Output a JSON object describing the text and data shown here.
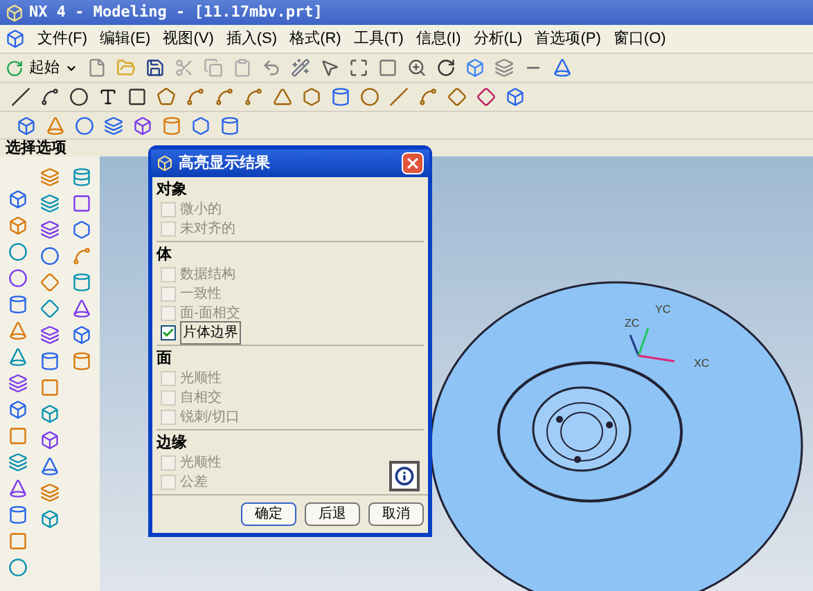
{
  "window": {
    "title": "NX 4 - Modeling - [11.17mbv.prt]"
  },
  "menu": [
    "文件(F)",
    "编辑(E)",
    "视图(V)",
    "插入(S)",
    "格式(R)",
    "工具(T)",
    "信息(I)",
    "分析(L)",
    "首选项(P)",
    "窗口(O)"
  ],
  "toolbar": {
    "start_button": "起始"
  },
  "selection_bar": {
    "label": "选择选项"
  },
  "viewport": {
    "axes": [
      "ZC",
      "YC",
      "XC"
    ]
  },
  "dialog": {
    "title": "高亮显示结果",
    "sections": [
      {
        "heading": "对象",
        "items": [
          {
            "label": "微小的",
            "checked": false,
            "disabled": true
          },
          {
            "label": "未对齐的",
            "checked": false,
            "disabled": true
          }
        ]
      },
      {
        "heading": "体",
        "items": [
          {
            "label": "数据结构",
            "checked": false,
            "disabled": true
          },
          {
            "label": "一致性",
            "checked": false,
            "disabled": true
          },
          {
            "label": "面-面相交",
            "checked": false,
            "disabled": true
          },
          {
            "label": "片体边界",
            "checked": true,
            "disabled": false
          }
        ]
      },
      {
        "heading": "面",
        "items": [
          {
            "label": "光顺性",
            "checked": false,
            "disabled": true
          },
          {
            "label": "自相交",
            "checked": false,
            "disabled": true
          },
          {
            "label": "锐刺/切口",
            "checked": false,
            "disabled": true
          }
        ]
      },
      {
        "heading": "边缘",
        "items": [
          {
            "label": "光顺性",
            "checked": false,
            "disabled": true
          },
          {
            "label": "公差",
            "checked": false,
            "disabled": true
          }
        ]
      }
    ],
    "buttons": [
      "确定",
      "后退",
      "取消"
    ]
  }
}
